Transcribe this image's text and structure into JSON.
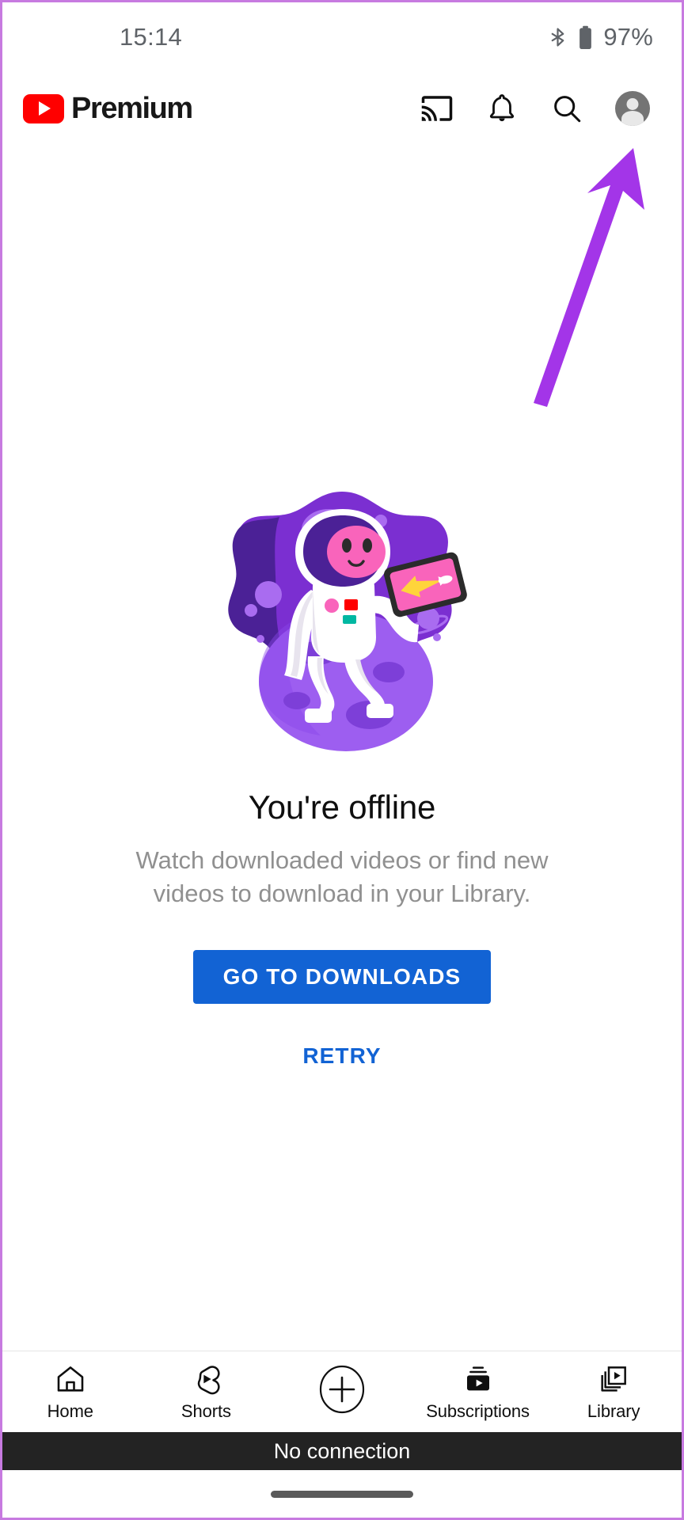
{
  "status_bar": {
    "time": "15:14",
    "battery_percent": "97%",
    "icons": [
      "bluetooth-icon",
      "battery-icon"
    ]
  },
  "app_bar": {
    "logo_icon": "youtube-play-icon",
    "brand_text": "Premium",
    "actions": [
      {
        "name": "cast-icon",
        "label": "Cast"
      },
      {
        "name": "notifications-bell-icon",
        "label": "Notifications"
      },
      {
        "name": "search-icon",
        "label": "Search"
      },
      {
        "name": "account-avatar",
        "label": "Account"
      }
    ]
  },
  "annotation": {
    "type": "arrow",
    "color": "#a335e8",
    "points_to": "account-avatar"
  },
  "main": {
    "illustration": {
      "name": "astronaut-on-moon-illustration",
      "colors": {
        "space_dark": "#4b2196",
        "space_mid": "#7b2fd1",
        "space_light": "#a96cf0",
        "moon": "#9d5ef0",
        "moon_crater": "#7d3fd8",
        "suit": "#ffffff",
        "suit_shadow": "#e8e4ee",
        "visor": "#4b2196",
        "face": "#f964bb",
        "tablet_frame": "#2b2b2b",
        "tablet_screen": "#f964bb",
        "rocket": "#ffd43b",
        "badge_red": "#ff0000",
        "badge_teal": "#00b8a2",
        "badge_pink": "#f964bb"
      }
    },
    "headline": "You're offline",
    "subtext": "Watch downloaded videos or find new videos to download in your Library.",
    "primary_button": "GO TO DOWNLOADS",
    "secondary_button": "RETRY",
    "accent_color": "#1263d4"
  },
  "bottom_nav": {
    "items": [
      {
        "label": "Home",
        "icon": "home-icon"
      },
      {
        "label": "Shorts",
        "icon": "shorts-icon"
      },
      {
        "label": "",
        "icon": "create-plus-icon"
      },
      {
        "label": "Subscriptions",
        "icon": "subscriptions-icon"
      },
      {
        "label": "Library",
        "icon": "library-icon"
      }
    ]
  },
  "snackbar": {
    "message": "No connection"
  },
  "gesture_bar": {
    "name": "home-gesture-indicator"
  }
}
